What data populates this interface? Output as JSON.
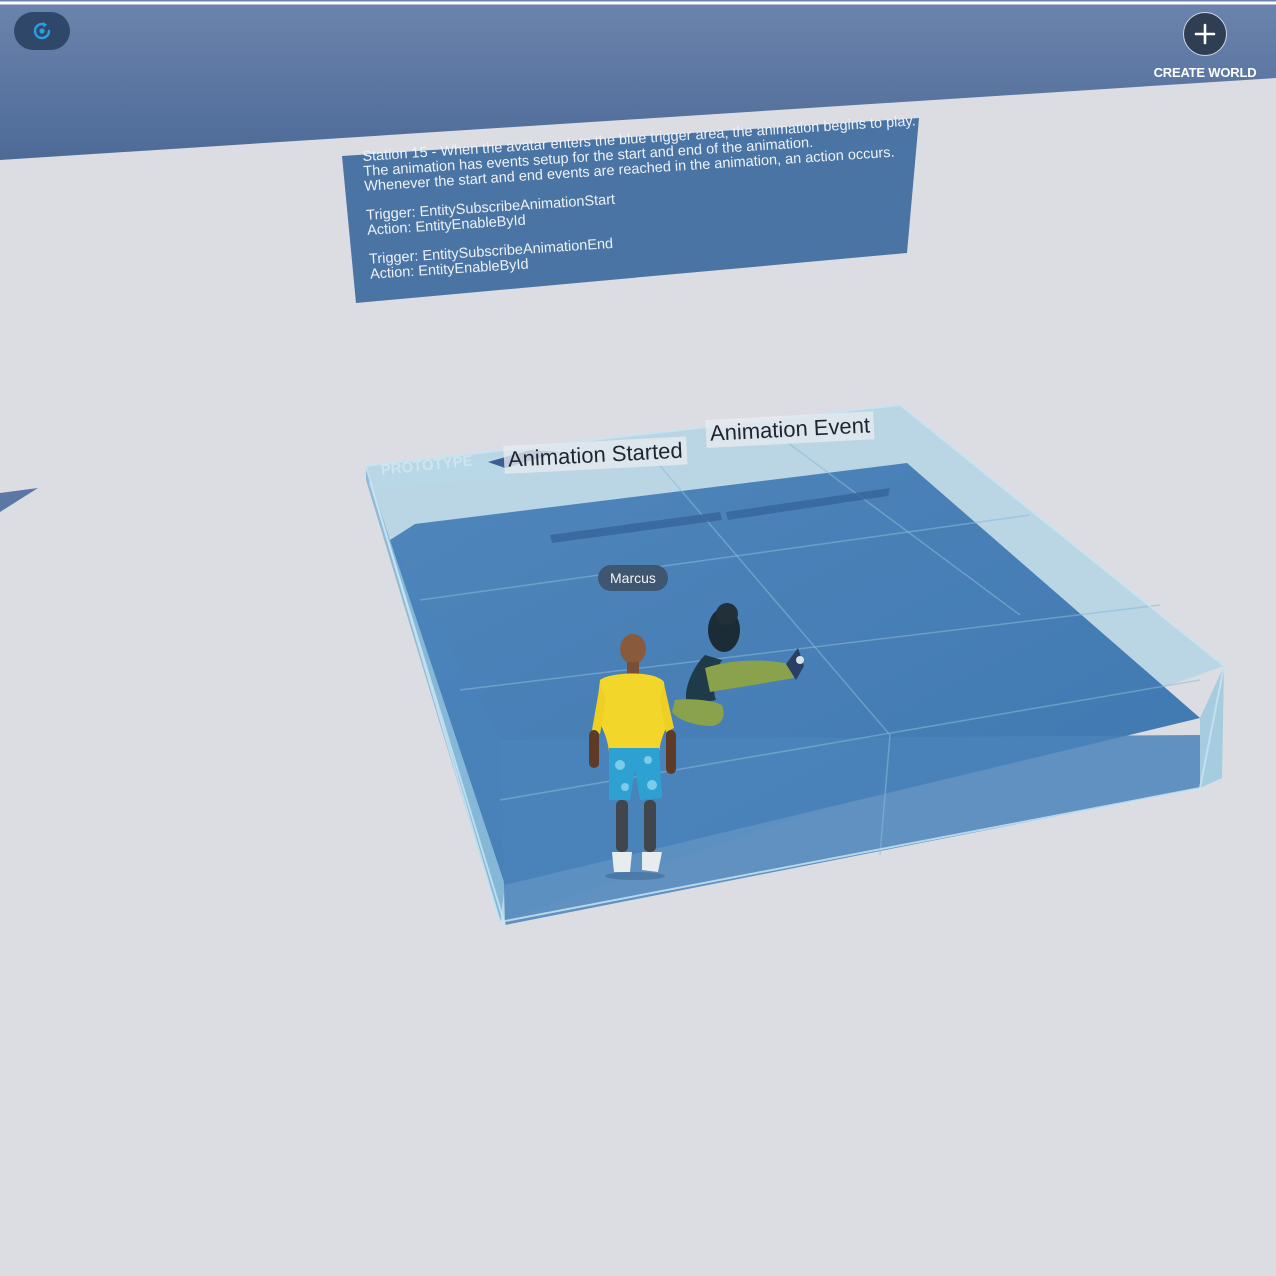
{
  "hud": {
    "logo_icon": "refresh-spark-icon",
    "create_world_icon": "plus-icon",
    "create_world_label": "CREATE WORLD"
  },
  "sign": {
    "lines": [
      "Station 15 - When the avatar enters the blue trigger area, the animation begins to play.",
      "The animation has events setup for the start and end of the animation.",
      "Whenever the start and end events are reached in the animation, an action occurs.",
      "",
      "Trigger: EntitySubscribeAnimationStart",
      "Action: EntityEnableById",
      "",
      "Trigger: EntitySubscribeAnimationEnd",
      "Action: EntityEnableById"
    ]
  },
  "world_labels": {
    "animation_started": "Animation Started",
    "animation_event": "Animation Event",
    "prototype_text": "PROTOTYPE"
  },
  "avatar": {
    "name": "Marcus"
  },
  "colors": {
    "sky_band": "#5e79a6",
    "ground": "#dcdde2",
    "trigger_volume": "#3f79b4",
    "sign_panel": "#4a74a4",
    "shirt": "#f2d62a",
    "shorts": "#2ea1d3"
  }
}
